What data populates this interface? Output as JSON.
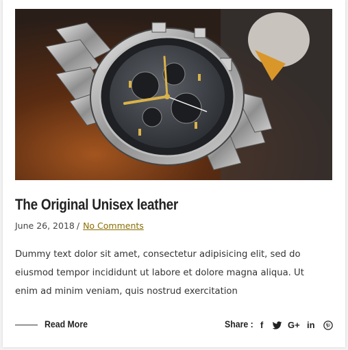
{
  "post": {
    "title": "The Original Unisex leather",
    "date": "June 26, 2018",
    "separator": "/",
    "comments_link": "No Comments",
    "excerpt": "Dummy text dolor sit amet, consectetur adipisicing elit, sed do eiusmod tempor incididunt ut labore et dolore magna aliqua. Ut enim ad minim veniam, quis nostrud exercitation",
    "image": {
      "subject": "wristwatch-photo"
    }
  },
  "footer": {
    "read_more": "Read More",
    "share_label": "Share :",
    "share_icons": [
      "facebook-icon",
      "twitter-icon",
      "google-plus-icon",
      "linkedin-icon",
      "pinterest-icon"
    ],
    "google_plus_text": "G+",
    "linkedin_text": "in",
    "facebook_text": "f"
  },
  "colors": {
    "accent_link": "#8a6d00",
    "title": "#222222",
    "text": "#333333",
    "card": "#ffffff"
  }
}
